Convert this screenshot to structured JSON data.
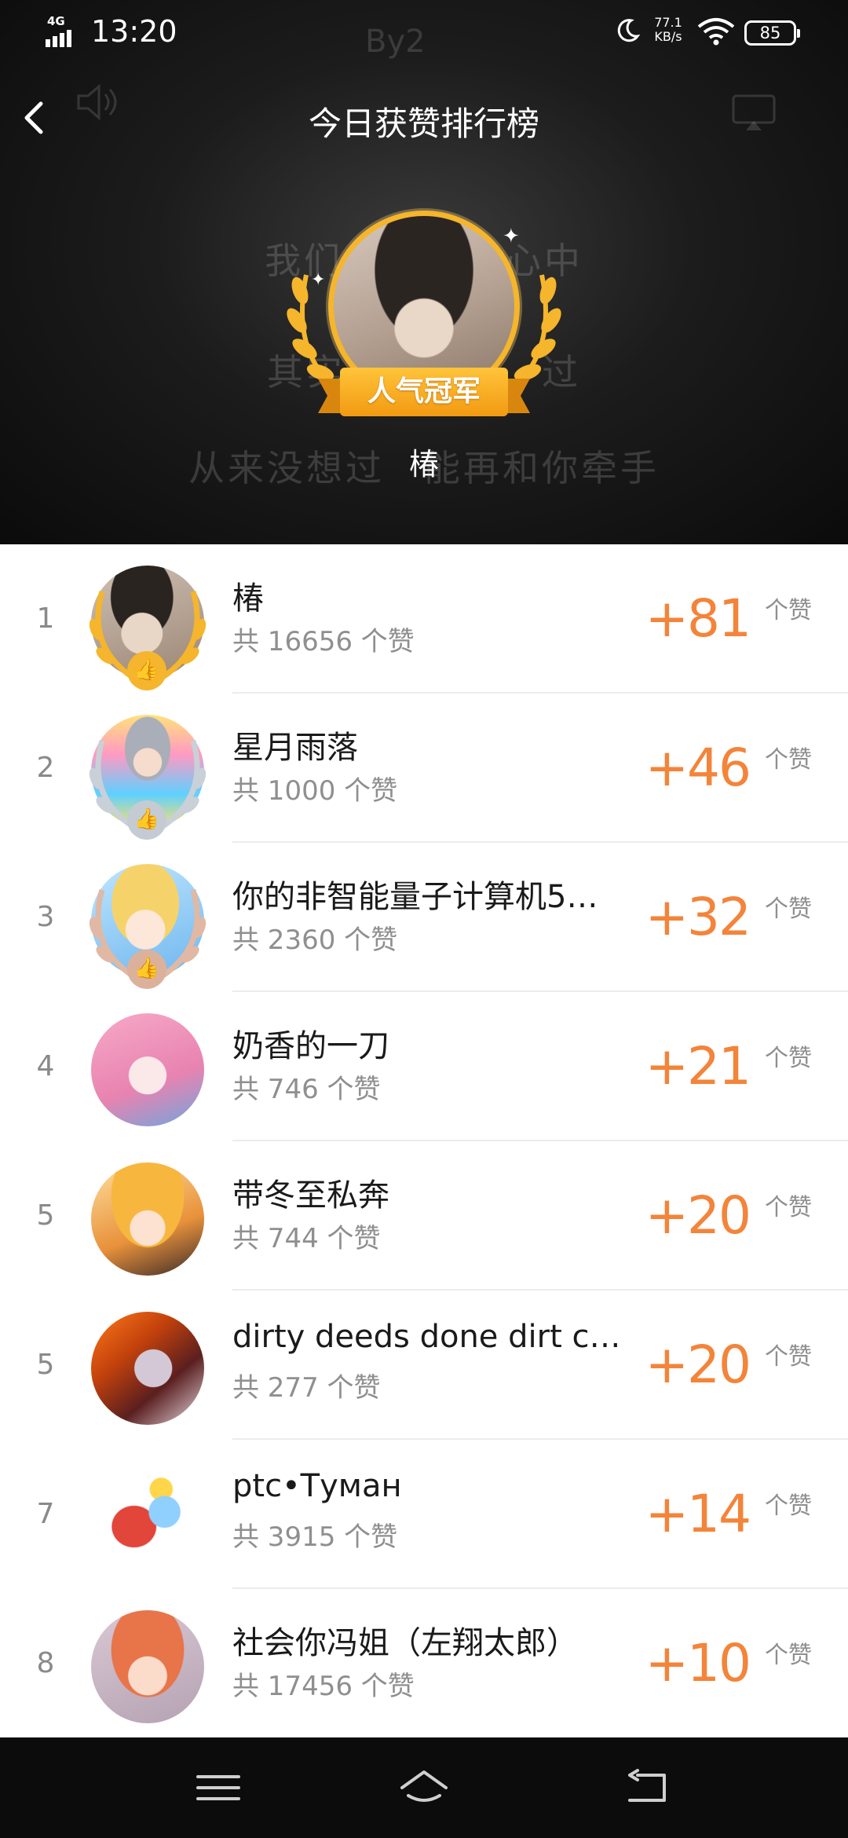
{
  "status_bar": {
    "network": "4G",
    "time": "13:20",
    "net_speed_value": "77.1",
    "net_speed_unit": "KB/s",
    "battery": "85"
  },
  "header": {
    "title": "今日获赞排行榜",
    "champion_badge": "人气冠军",
    "champion_name": "椿"
  },
  "ranking": [
    {
      "rank": "1",
      "name": "椿",
      "total": "共 16656 个赞",
      "gain": "+81",
      "unit": "个赞"
    },
    {
      "rank": "2",
      "name": "星月雨落",
      "total": "共 1000 个赞",
      "gain": "+46",
      "unit": "个赞"
    },
    {
      "rank": "3",
      "name": "你的非智能量子计算机5…",
      "total": "共 2360 个赞",
      "gain": "+32",
      "unit": "个赞"
    },
    {
      "rank": "4",
      "name": "奶香的一刀",
      "total": "共 746 个赞",
      "gain": "+21",
      "unit": "个赞"
    },
    {
      "rank": "5",
      "name": "带冬至私奔",
      "total": "共 744 个赞",
      "gain": "+20",
      "unit": "个赞"
    },
    {
      "rank": "5",
      "name": "dirty deeds done dirt c…",
      "total": "共 277 个赞",
      "gain": "+20",
      "unit": "个赞"
    },
    {
      "rank": "7",
      "name": "ptc•Туман",
      "total": "共 3915 个赞",
      "gain": "+14",
      "unit": "个赞"
    },
    {
      "rank": "8",
      "name": "社会你冯姐（左翔太郎）",
      "total": "共 17456 个赞",
      "gain": "+10",
      "unit": "个赞"
    }
  ],
  "colors": {
    "accent": "#f3843a",
    "gold": "#f5b52c",
    "silver": "#c9d0d8",
    "bronze": "#e0b8a4"
  }
}
